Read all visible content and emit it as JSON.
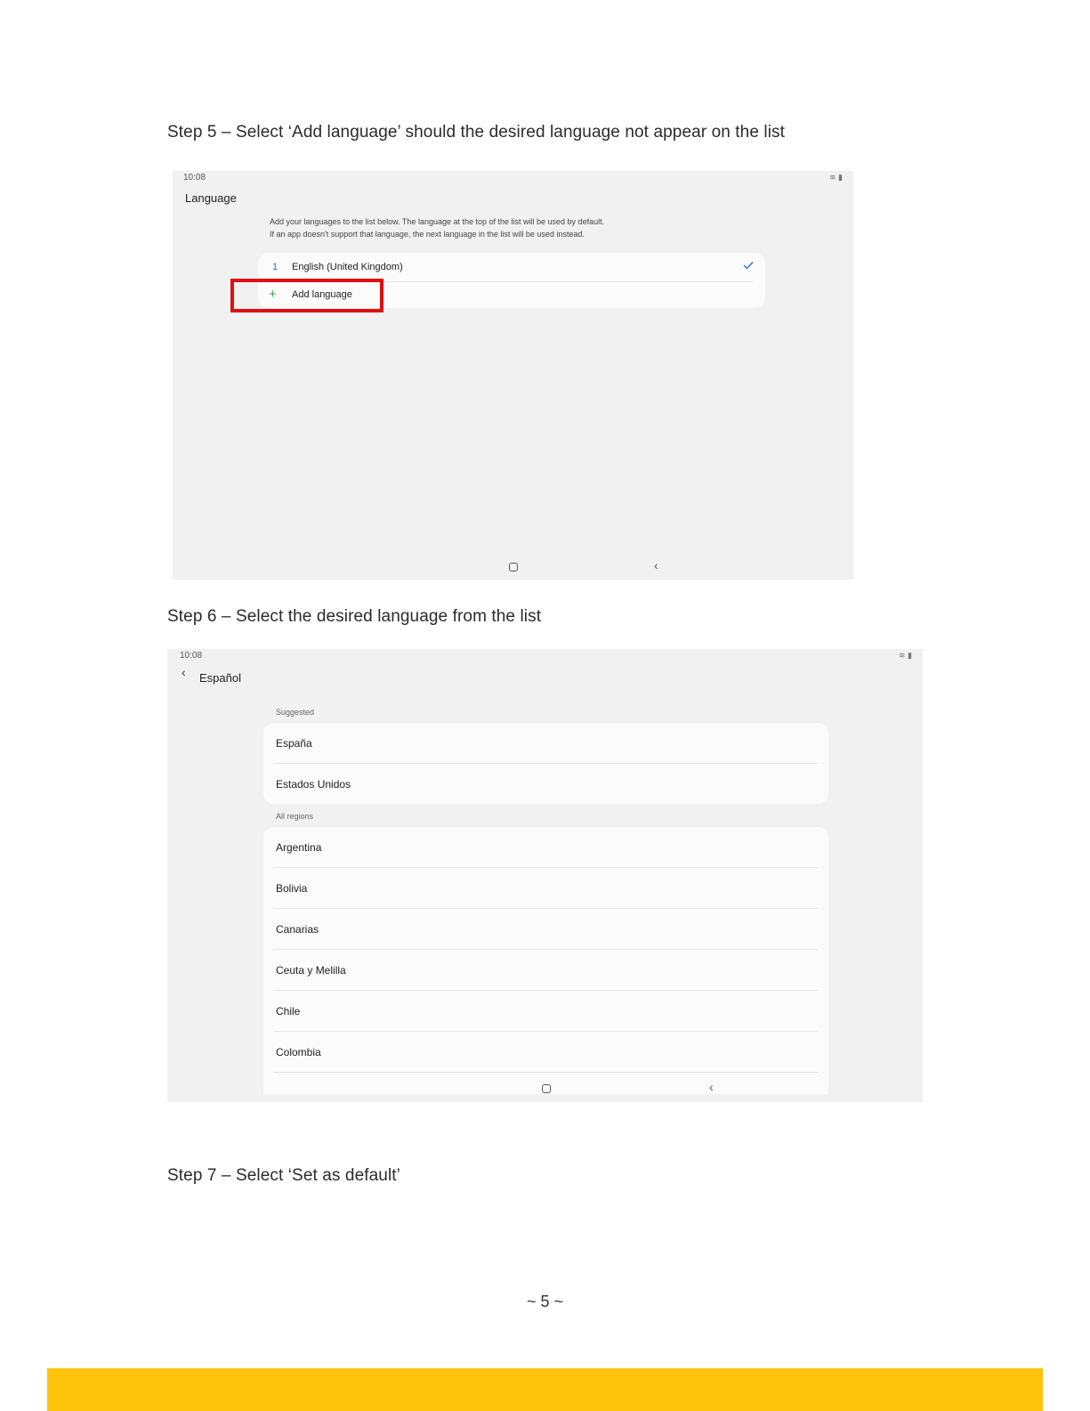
{
  "step5": {
    "text": "Step 5 – Select ‘Add language’ should the desired language not appear on the list"
  },
  "screenshot1": {
    "status_time": "10:08",
    "title": "Language",
    "description_line1": "Add your languages to the list below. The language at the top of the list will be used by default.",
    "description_line2": "If an app doesn't support that language, the next language in the list will be used instead.",
    "languages": [
      {
        "number": "1",
        "name": "English (United Kingdom)"
      }
    ],
    "add_language_label": "Add language",
    "highlight_color": "#e01010"
  },
  "step6": {
    "text": "Step 6 – Select the desired language from the list"
  },
  "screenshot2": {
    "status_time": "10:08",
    "title": "Español",
    "suggested_label": "Suggested",
    "suggested": [
      "España",
      "Estados Unidos"
    ],
    "all_regions_label": "All regions",
    "regions": [
      "Argentina",
      "Bolivia",
      "Canarias",
      "Ceuta y Melilla",
      "Chile",
      "Colombia"
    ]
  },
  "step7": {
    "text": "Step 7 – Select ‘Set as default’"
  },
  "page_number": "~ 5 ~",
  "footer_color": "#fdc20c"
}
